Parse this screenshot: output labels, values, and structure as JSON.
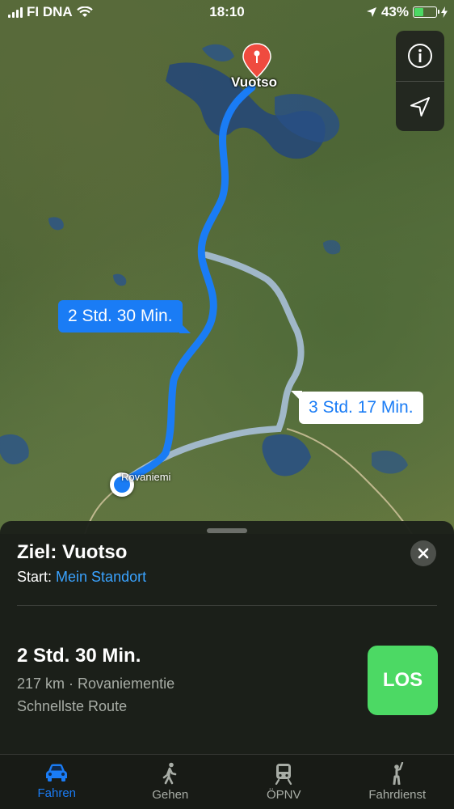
{
  "status_bar": {
    "carrier": "FI DNA",
    "time": "18:10",
    "battery_percent": "43%",
    "battery_level": 0.43
  },
  "map": {
    "destination_label": "Vuotso",
    "origin_label": "Rovaniemi",
    "route_primary_duration": "2 Std. 30 Min.",
    "route_alternative_duration": "3 Std. 17 Min.",
    "controls": [
      {
        "icon": "info-icon"
      },
      {
        "icon": "location-arrow-icon"
      }
    ]
  },
  "sheet": {
    "title": "Ziel: Vuotso",
    "start_prefix": "Start:",
    "start_value": "Mein Standort",
    "route": {
      "duration": "2 Std. 30 Min.",
      "details": "217 km · Rovaniementie",
      "note": "Schnellste Route",
      "go_label": "LOS"
    }
  },
  "tabs": [
    {
      "label": "Fahren",
      "icon": "car-icon",
      "active": true
    },
    {
      "label": "Gehen",
      "icon": "walking-icon",
      "active": false
    },
    {
      "label": "ÖPNV",
      "icon": "train-icon",
      "active": false
    },
    {
      "label": "Fahrdienst",
      "icon": "hailing-person-icon",
      "active": false
    }
  ],
  "colors": {
    "accent": "#1a7cf5",
    "go_button": "#4cd964",
    "alt_route": "#a9c0d8",
    "pin": "#ef4b3f"
  }
}
